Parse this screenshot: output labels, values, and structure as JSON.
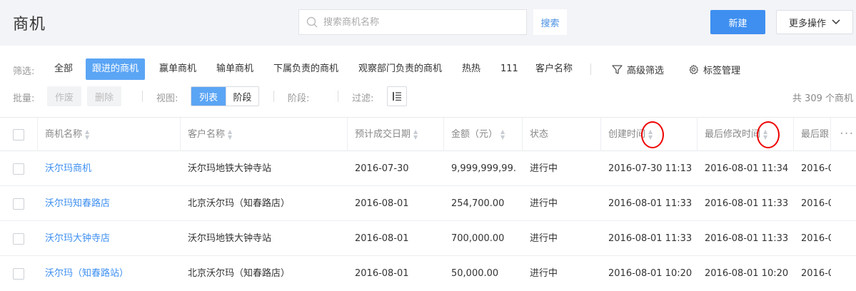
{
  "header": {
    "title": "商机",
    "search_placeholder": "搜索商机名称",
    "search_label": "搜索",
    "new_label": "新建",
    "more_label": "更多操作"
  },
  "filters": {
    "label": "筛选:",
    "items": [
      "全部",
      "跟进的商机",
      "赢单商机",
      "输单商机",
      "下属负责的商机",
      "观察部门负责的商机",
      "热热",
      "111",
      "客户名称"
    ],
    "active_index": 1,
    "advanced_label": "高级筛选",
    "tag_label": "标签管理"
  },
  "batch": {
    "label": "批量:",
    "void_label": "作废",
    "delete_label": "删除",
    "view_label": "视图:",
    "view_list": "列表",
    "view_stage": "阶段",
    "stage_label": "阶段:",
    "filter_label": "过滤:",
    "total": "共 309 个商机"
  },
  "table": {
    "columns": [
      "商机名称",
      "客户名称",
      "预计成交日期",
      "金额（元）",
      "状态",
      "创建时间",
      "最后修改时间",
      "最后跟"
    ],
    "rows": [
      [
        "沃尔玛商机",
        "沃尔玛地铁大钟寺站",
        "2016-07-30",
        "9,999,999,99...",
        "进行中",
        "2016-07-30 11:13",
        "2016-08-01 11:34",
        "2016-0"
      ],
      [
        "沃尔玛知春路店",
        "北京沃尔玛（知春路店）",
        "2016-08-01",
        "254,700.00",
        "进行中",
        "2016-08-01 11:33",
        "2016-08-01 11:33",
        "2016-0"
      ],
      [
        "沃尔玛大钟寺店",
        "沃尔玛地铁大钟寺站",
        "2016-08-01",
        "700,000.00",
        "进行中",
        "2016-08-01 11:33",
        "2016-08-01 11:33",
        "2016-0"
      ],
      [
        "沃尔玛（知春路站）",
        "北京沃尔玛（知春路店）",
        "2016-08-01",
        "50,000.00",
        "进行中",
        "2016-08-01 10:20",
        "2016-08-01 10:20",
        "2016-0"
      ]
    ]
  },
  "colors": {
    "accent": "#3e8ff0",
    "active_filter": "#5ba5f5",
    "annotation": "#e00000"
  }
}
